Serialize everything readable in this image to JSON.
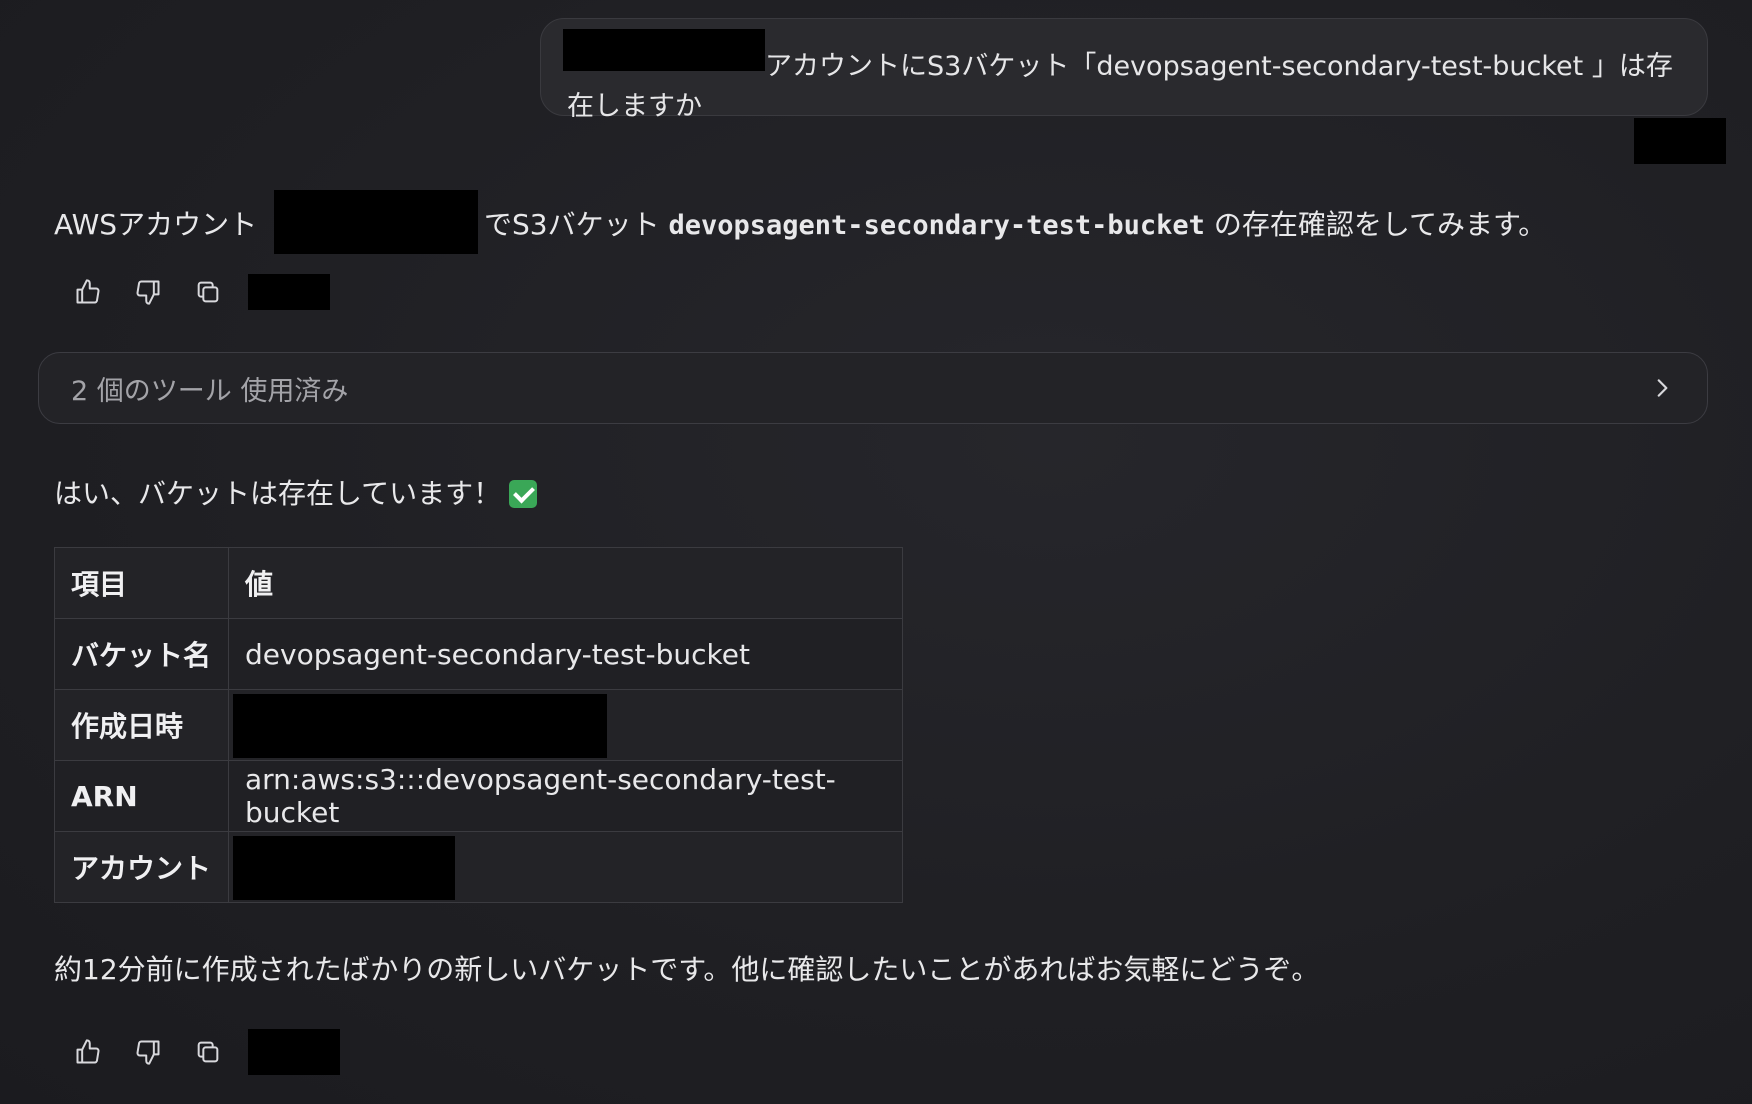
{
  "user_message": {
    "line1": "アカウントにS3バケット「devopsagent-secondary-test-bucket 」は存",
    "line2": "在しますか"
  },
  "assistant_intro": {
    "prefix": "AWSアカウント",
    "middle": "でS3バケット",
    "bucket": "devopsagent-secondary-test-bucket",
    "suffix": "の存在確認をしてみます。"
  },
  "tool_usage": {
    "label": "2 個のツール 使用済み"
  },
  "answer": {
    "text": "はい、バケットは存在しています！"
  },
  "table": {
    "headers": [
      "項目",
      "値"
    ],
    "rows": [
      {
        "key": "バケット名",
        "value": "devopsagent-secondary-test-bucket"
      },
      {
        "key": "作成日時",
        "value": ""
      },
      {
        "key": "ARN",
        "value": "arn:aws:s3:::devopsagent-secondary-test-bucket"
      },
      {
        "key": "アカウント",
        "value": ""
      }
    ]
  },
  "closing": {
    "text": "約12分前に作成されたばかりの新しいバケットです。他に確認したいことがあればお気軽にどうぞ。"
  }
}
